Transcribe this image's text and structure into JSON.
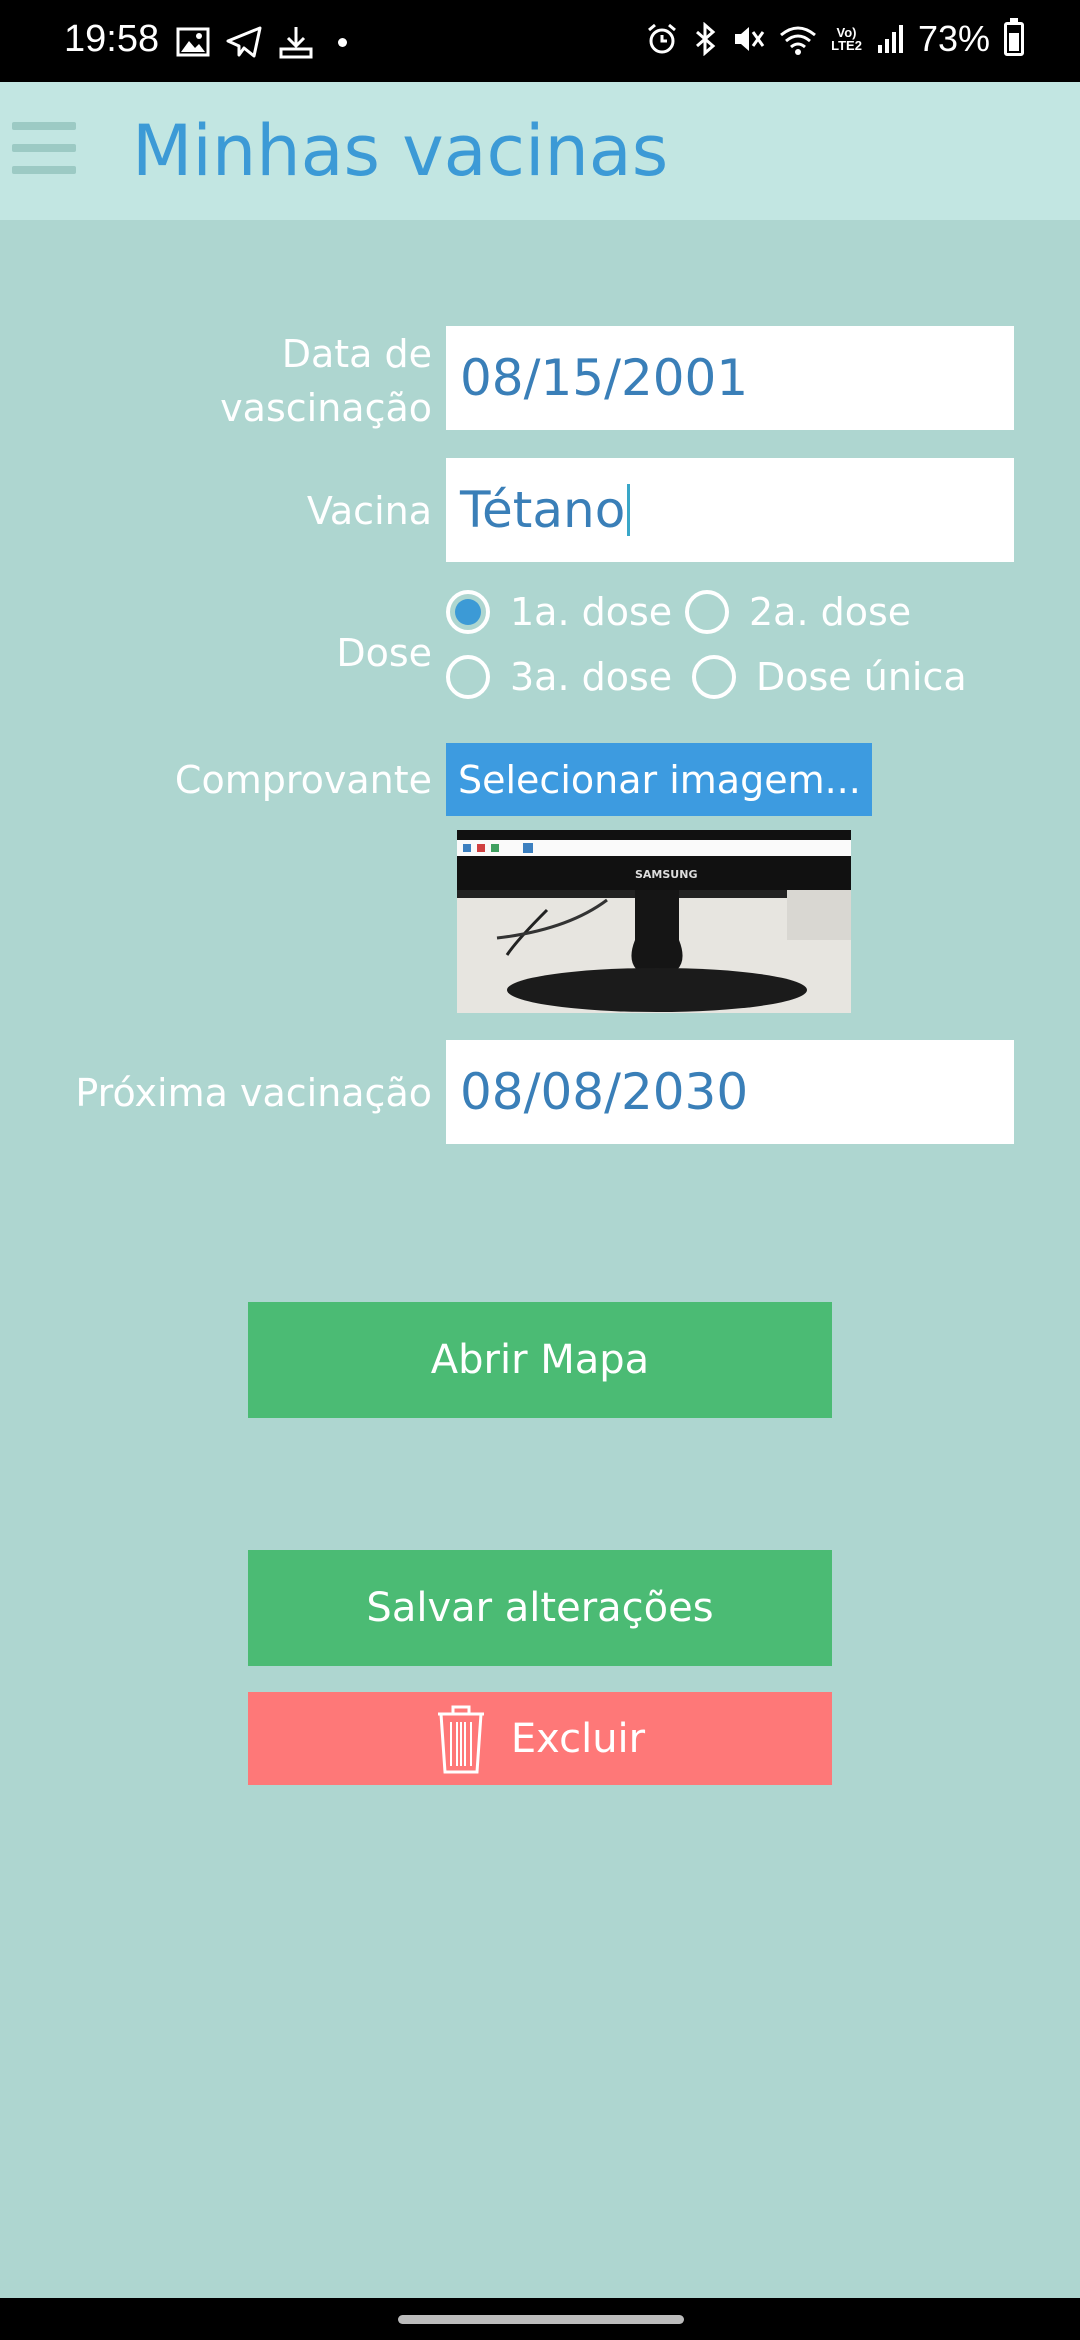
{
  "status_bar": {
    "time": "19:58",
    "battery_percent": "73%",
    "network_badge_top": "Vo)",
    "network_badge_bottom": "LTE2",
    "icons": [
      "gallery-icon",
      "telegram-icon",
      "download-icon",
      "alarm-icon",
      "bluetooth-icon",
      "mute-icon",
      "wifi-icon",
      "signal-icon",
      "battery-icon"
    ]
  },
  "header": {
    "title": "Minhas vacinas",
    "menu_icon": "hamburger-menu-icon"
  },
  "form": {
    "vaccination_date": {
      "label_line1": "Data de",
      "label_line2": "vascinação",
      "value": "08/15/2001"
    },
    "vaccine": {
      "label": "Vacina",
      "value": "Tétano"
    },
    "dose": {
      "label": "Dose",
      "options": [
        {
          "label": "1a. dose",
          "checked": true
        },
        {
          "label": "2a. dose",
          "checked": false
        },
        {
          "label": "3a. dose",
          "checked": false
        },
        {
          "label": "Dose única",
          "checked": false
        }
      ]
    },
    "proof": {
      "label": "Comprovante",
      "button_label": "Selecionar imagem...",
      "image_brand_text": "SAMSUNG"
    },
    "next_vaccination": {
      "label": "Próxima vacinação",
      "value": "08/08/2030"
    }
  },
  "actions": {
    "open_map": "Abrir Mapa",
    "save_changes": "Salvar alterações",
    "delete": "Excluir"
  },
  "colors": {
    "background": "#aed6d0",
    "header": "#c2e6e2",
    "title": "#3c9ad6",
    "green_button": "#4bbb74",
    "red_button": "#fe7878",
    "select_button": "#3d9be0"
  }
}
